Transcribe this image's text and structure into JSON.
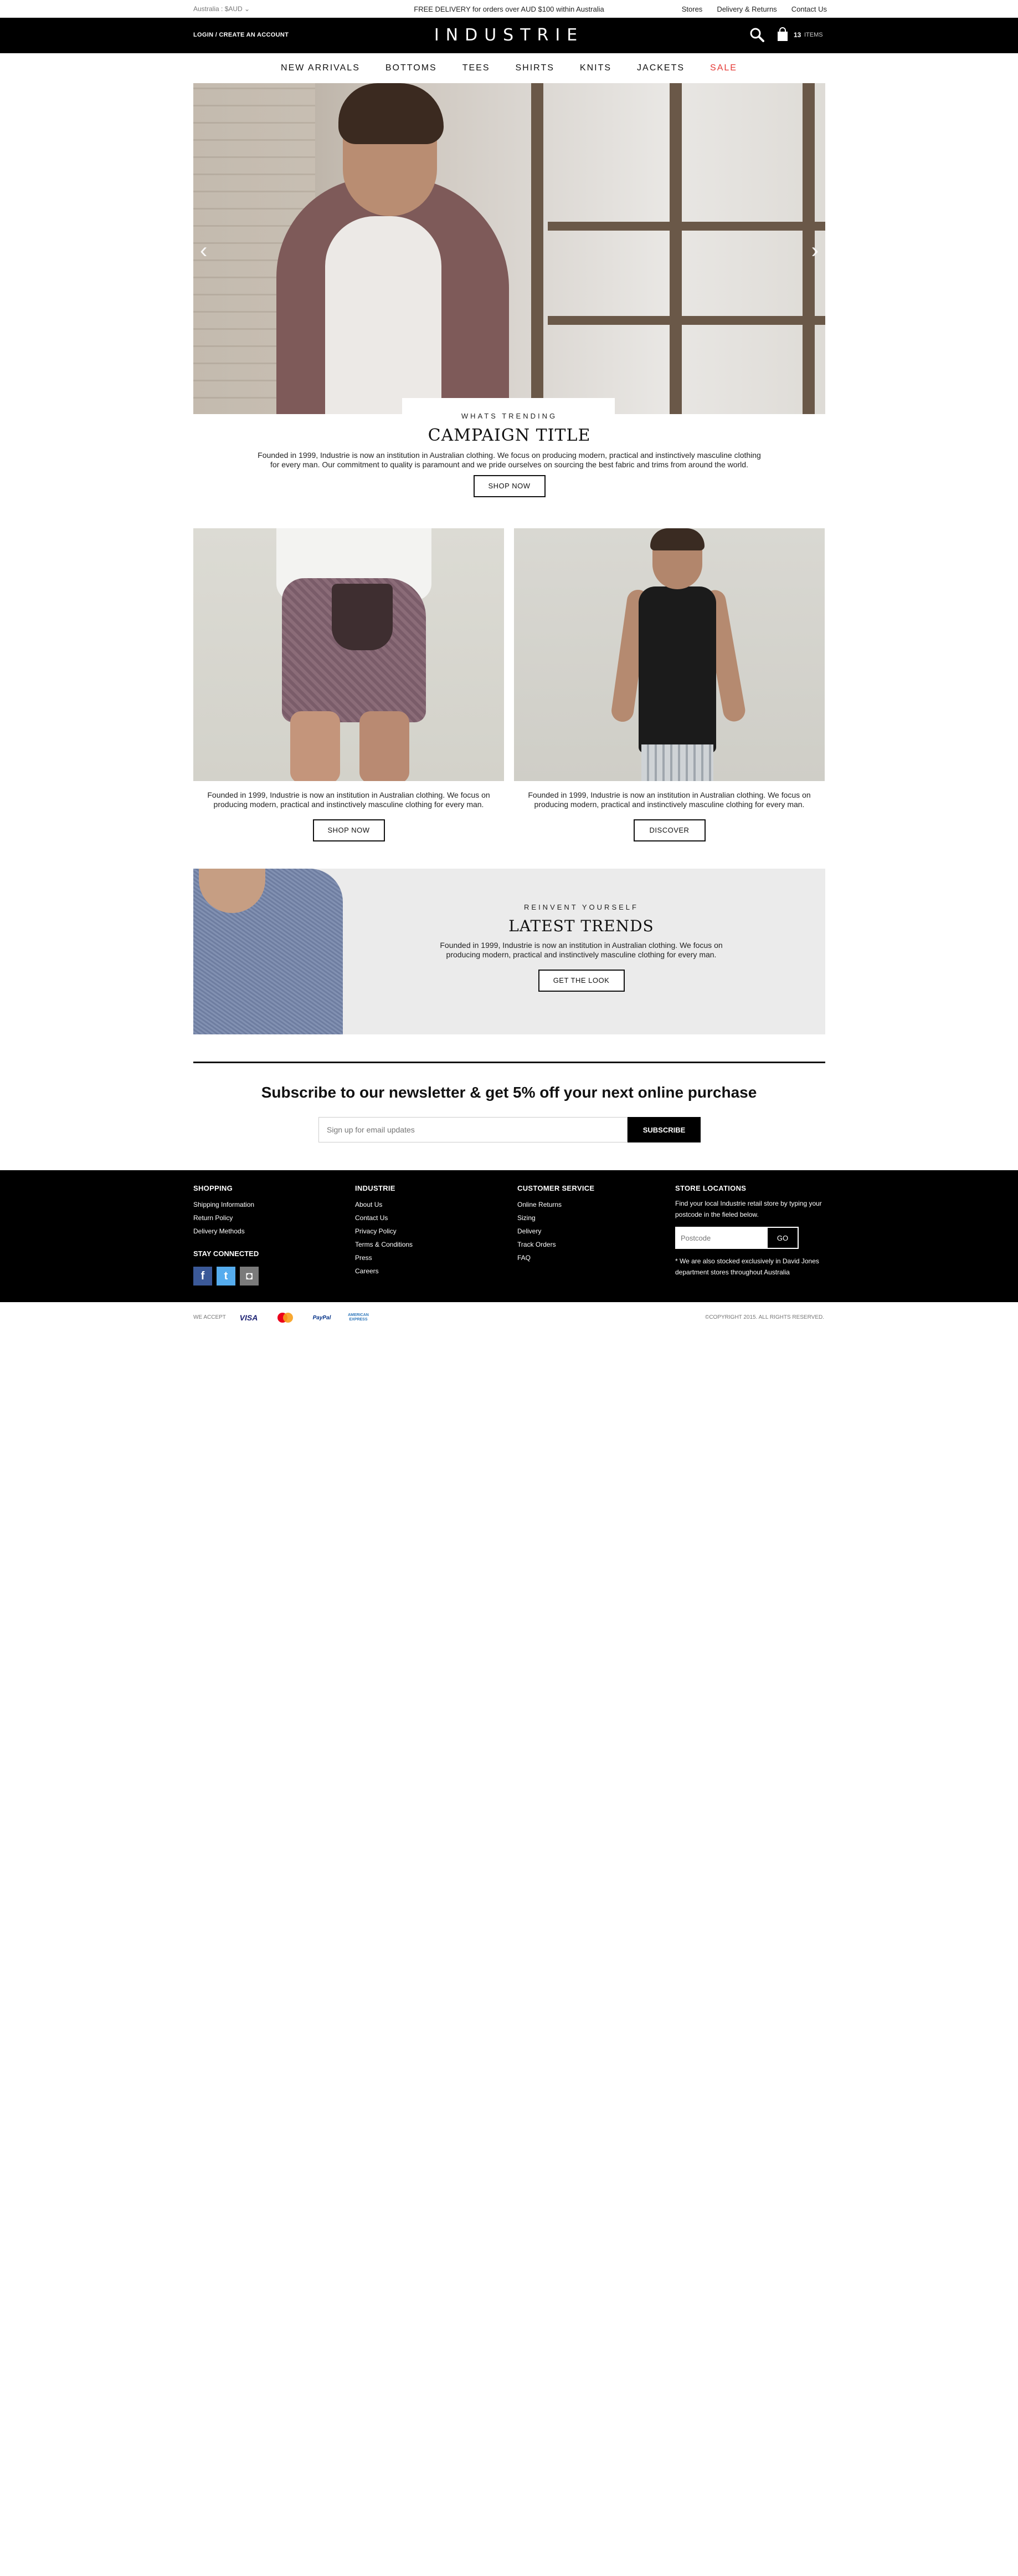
{
  "topbar": {
    "region": "Australia : $AUD",
    "promo": "FREE DELIVERY for orders over AUD $100 within Australia",
    "links": [
      "Stores",
      "Delivery & Returns",
      "Contact Us"
    ]
  },
  "header": {
    "login": "LOGIN",
    "create_account": "CREATE AN ACCOUNT",
    "logo": "INDUSTRIE",
    "cart_count": "13",
    "cart_label": "ITEMS"
  },
  "nav": {
    "items": [
      "NEW ARRIVALS",
      "BOTTOMS",
      "TEES",
      "SHIRTS",
      "KNITS",
      "JACKETS",
      "SALE"
    ],
    "sale_color": "#e53935"
  },
  "hero": {
    "eyebrow": "WHATS TRENDING",
    "title": "CAMPAIGN TITLE",
    "description": "Founded in 1999, Industrie is now an institution in Australian clothing. We focus on producing modern, practical and instinctively masculine clothing for every man. Our commitment to quality is paramount and we pride ourselves on sourcing the best fabric and trims from around the world.",
    "button": "SHOP NOW"
  },
  "promos": [
    {
      "description": "Founded in 1999, Industrie is now an institution in Australian clothing. We focus on producing modern, practical and instinctively masculine clothing for every man.",
      "button": "SHOP NOW"
    },
    {
      "description": "Founded in 1999, Industrie is now an institution in Australian clothing. We focus on producing modern, practical and instinctively masculine clothing for every man.",
      "button": "DISCOVER"
    }
  ],
  "trends": {
    "eyebrow": "REINVENT YOURSELF",
    "title": "LATEST TRENDS",
    "description": "Founded in 1999, Industrie is now an institution in Australian clothing. We focus on producing modern, practical and instinctively masculine clothing for every man.",
    "button": "GET THE LOOK"
  },
  "newsletter": {
    "title": "Subscribe to our newsletter & get 5% off your next online purchase",
    "placeholder": "Sign up for email updates",
    "button": "SUBSCRIBE"
  },
  "footer": {
    "shopping": {
      "heading": "SHOPPING",
      "links": [
        "Shipping Information",
        "Return Policy",
        "Delivery Methods"
      ]
    },
    "industrie": {
      "heading": "INDUSTRIE",
      "links": [
        "About Us",
        "Contact Us",
        "Privacy Policy",
        "Terms & Conditions",
        "Press",
        "Careers"
      ]
    },
    "service": {
      "heading": "CUSTOMER SERVICE",
      "links": [
        "Online Returns",
        "Sizing",
        "Delivery",
        "Track Orders",
        "FAQ"
      ]
    },
    "stores": {
      "heading": "STORE LOCATIONS",
      "text": "Find your local Industrie retail store by typing your postcode in the fieled below.",
      "placeholder": "Postcode",
      "button": "GO",
      "note": "* We are also stocked exclusively in David Jones department stores throughout Australia"
    },
    "stay_connected": "STAY CONNECTED",
    "social_icons": [
      "facebook-icon",
      "twitter-icon",
      "instagram-icon"
    ]
  },
  "bottombar": {
    "accept": "WE ACCEPT",
    "cards": [
      "VISA",
      "mastercard",
      "PayPal",
      "AMERICAN EXPRESS"
    ],
    "copyright": "©COPYRIGHT 2015. ALL RIGHTS RESERVED."
  }
}
